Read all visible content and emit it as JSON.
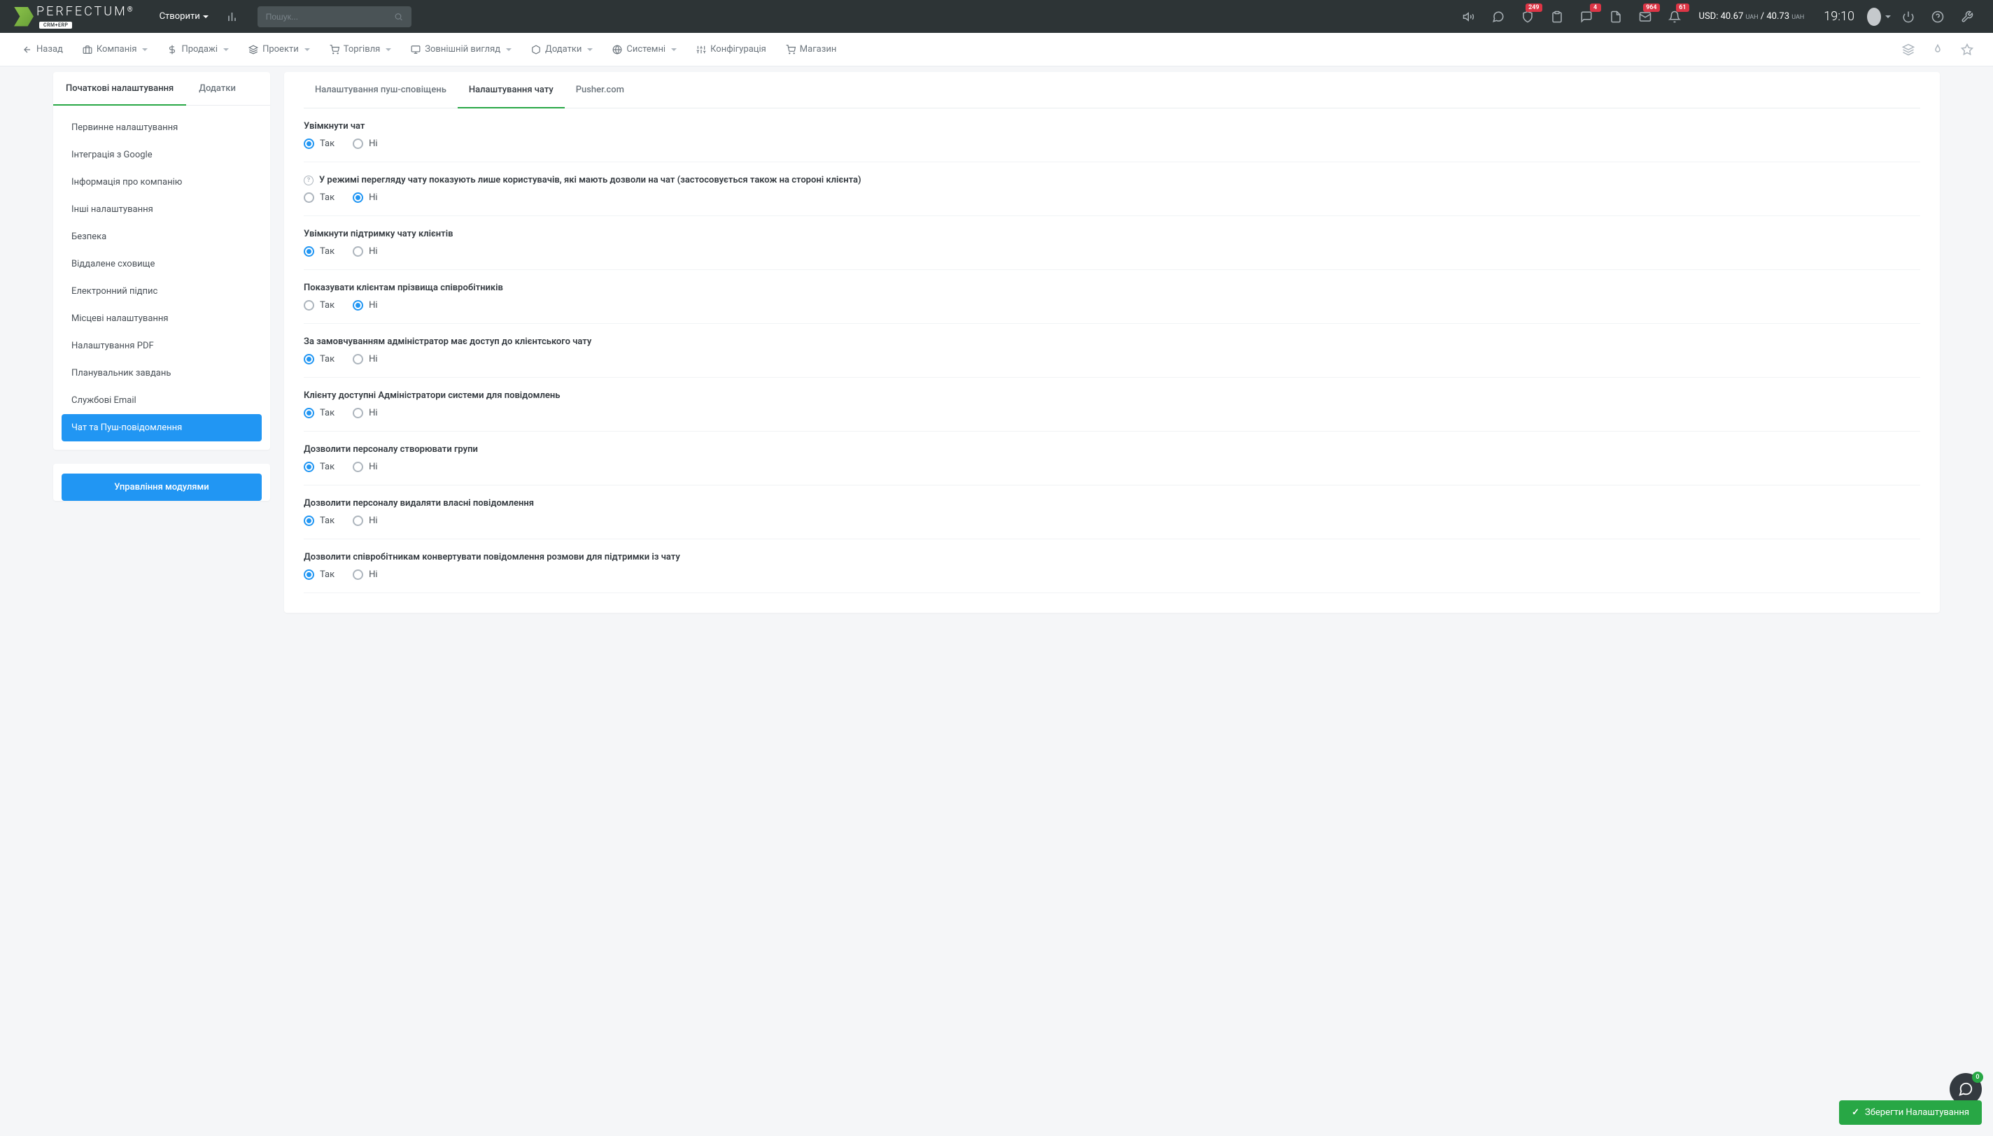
{
  "header": {
    "logo_text": "PERFECTUM",
    "logo_badge": "CRM+ERP",
    "create_label": "Створити",
    "search_placeholder": "Пошук...",
    "badges": {
      "shield": "249",
      "chat": "4",
      "envelope": "964",
      "bell": "61"
    },
    "currency": {
      "label": "USD:",
      "buy": "40.67",
      "buy_unit": "UAH",
      "sep": "/",
      "sell": "40.73",
      "sell_unit": "UAH"
    },
    "time": "19:10"
  },
  "nav": {
    "back": "Назад",
    "company": "Компанія",
    "sales": "Продажі",
    "projects": "Проекти",
    "trade": "Торгівля",
    "appearance": "Зовнішній вигляд",
    "addons": "Додатки",
    "system": "Системні",
    "config": "Конфігурація",
    "shop": "Магазин"
  },
  "sidebar": {
    "tabs": [
      {
        "label": "Початкові налаштування",
        "active": true
      },
      {
        "label": "Додатки",
        "active": false
      }
    ],
    "menu": [
      {
        "label": "Первинне налаштування"
      },
      {
        "label": "Інтеграція з Google"
      },
      {
        "label": "Інформація про компанію"
      },
      {
        "label": "Інші налаштування"
      },
      {
        "label": "Безпека"
      },
      {
        "label": "Віддалене сховище"
      },
      {
        "label": "Електронний підпис"
      },
      {
        "label": "Місцеві налаштування"
      },
      {
        "label": "Налаштування PDF"
      },
      {
        "label": "Планувальник завдань"
      },
      {
        "label": "Службові Email"
      },
      {
        "label": "Чат та Пуш-повідомлення",
        "active": true
      }
    ],
    "module_btn": "Управління модулями"
  },
  "content": {
    "tabs": [
      {
        "label": "Налаштування пуш-сповіщень",
        "active": false
      },
      {
        "label": "Налаштування чату",
        "active": true
      },
      {
        "label": "Pusher.com",
        "active": false
      }
    ],
    "yes": "Так",
    "no": "Ні",
    "settings": [
      {
        "label": "Увімкнути чат",
        "value": "yes",
        "help": false
      },
      {
        "label": "У режимі перегляду чату показують лише користувачів, які мають дозволи на чат (застосовується також на стороні клієнта)",
        "value": "no",
        "help": true
      },
      {
        "label": "Увімкнути підтримку чату клієнтів",
        "value": "yes",
        "help": false
      },
      {
        "label": "Показувати клієнтам прізвища співробітників",
        "value": "no",
        "help": false
      },
      {
        "label": "За замовчуванням адміністратор має доступ до клієнтського чату",
        "value": "yes",
        "help": false
      },
      {
        "label": "Клієнту доступні Адміністратори системи для повідомлень",
        "value": "yes",
        "help": false
      },
      {
        "label": "Дозволити персоналу створювати групи",
        "value": "yes",
        "help": false
      },
      {
        "label": "Дозволити персоналу видаляти власні повідомлення",
        "value": "yes",
        "help": false
      },
      {
        "label": "Дозволити співробітникам конвертувати повідомлення розмови для підтримки із чату",
        "value": "yes",
        "help": false
      }
    ]
  },
  "save_btn": "Зберегти Налаштування",
  "chat_widget_count": "0"
}
